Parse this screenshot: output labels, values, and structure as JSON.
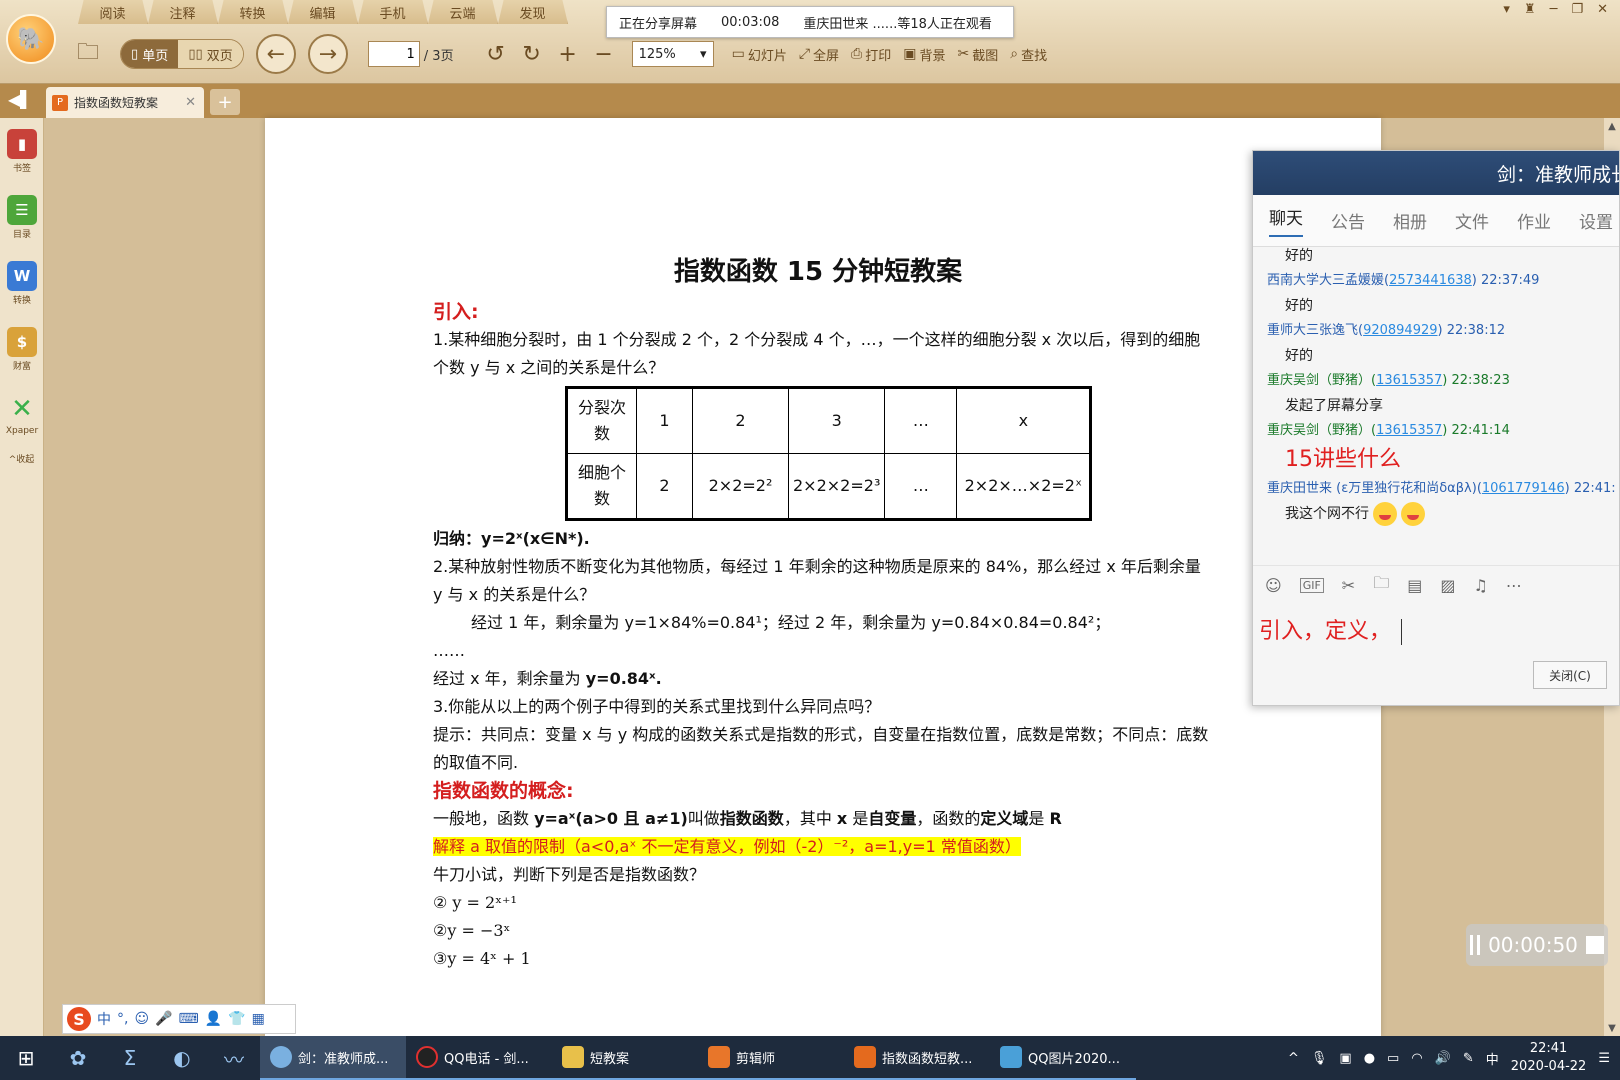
{
  "menu": [
    "阅读",
    "注释",
    "转换",
    "编辑",
    "手机",
    "云端",
    "发现"
  ],
  "share": {
    "status": "正在分享屏幕",
    "time": "00:03:08",
    "viewers": "重庆田世来 ......等18人正在观看"
  },
  "toolbar": {
    "single_page": "单页",
    "double_page": "双页",
    "page_current": "1",
    "page_total": "/ 3页",
    "zoom": "125%",
    "tools": [
      "幻灯片",
      "全屏",
      "打印",
      "背景",
      "截图",
      "查找"
    ]
  },
  "tab": {
    "title": "指数函数短教案"
  },
  "sidebar": [
    "书签",
    "目录",
    "转换",
    "财富",
    "Xpaper"
  ],
  "sidebar_collapse": "收起",
  "doc": {
    "title": "指数函数 15 分钟短教案",
    "sec1": "引入:",
    "q1": "1.某种细胞分裂时，由 1 个分裂成 2 个，2 个分裂成 4 个，…，一个这样的细胞分裂 x 次以后，得到的细胞个数 y 与 x 之间的关系是什么？",
    "table": {
      "row1": [
        "分裂次数",
        "1",
        "2",
        "3",
        "…",
        "x"
      ],
      "row2": [
        "细胞个数",
        "2",
        "2×2=2²",
        "2×2×2=2³",
        "…",
        "2×2×…×2=2ˣ"
      ]
    },
    "summary_label": "归纳：",
    "summary_formula": "y=2ˣ(x∈N*).",
    "q2": "2.某种放射性物质不断变化为其他物质，每经过 1 年剩余的这种物质是原来的 84%，那么经过 x 年后剩余量 y 与 x 的关系是什么？",
    "q2_a": "经过 1 年，剩余量为 y=1×84%=0.84¹；经过 2 年，剩余量为 y=0.84×0.84=0.84²；",
    "ellipsis": "……",
    "q2_b_pre": "经过 x 年，剩余量为 ",
    "q2_b_formula": "y=0.84ˣ.",
    "q3": "3.你能从以上的两个例子中得到的关系式里找到什么异同点吗？",
    "hint": "提示：共同点：变量 x 与 y 构成的函数关系式是指数的形式，自变量在指数位置，底数是常数；不同点：底数的取值不同.",
    "sec2": "指数函数的概念:",
    "def_1": "一般地，函数 ",
    "def_formula": "y=aˣ(a>0 且 a≠1)",
    "def_2": "叫做",
    "def_term": "指数函数",
    "def_3": "，其中 ",
    "def_x": "x",
    "def_4": " 是",
    "def_var": "自变量",
    "def_5": "，函数的",
    "def_domain": "定义域",
    "def_6": "是 ",
    "def_R": "R",
    "highlight": "解释 a 取值的限制（a<0,aˣ 不一定有意义，例如（-2）⁻²，a=1,y=1 常值函数）",
    "quiz": "牛刀小试，判断下列是否是指数函数？",
    "items": [
      "②  y = 2ˣ⁺¹",
      "②y = −3ˣ",
      "③y = 4ˣ + 1"
    ]
  },
  "chat": {
    "title": "剑：准教师成长",
    "tabs": [
      "聊天",
      "公告",
      "相册",
      "文件",
      "作业",
      "设置"
    ],
    "messages": [
      {
        "text": "好的"
      },
      {
        "name": "西南大学大三孟媛媛(",
        "qq": "2573441638",
        "time": ") 22:37:49",
        "text": "好的"
      },
      {
        "name": "重师大三张逸飞(",
        "qq": "920894929",
        "time": ") 22:38:12",
        "text": "好的"
      },
      {
        "name": "重庆吴剑（野猪）(",
        "qq": "13615357",
        "time": ") 22:38:23",
        "text": "发起了屏幕分享"
      },
      {
        "name": "重庆吴剑（野猪）(",
        "qq": "13615357",
        "time": ") 22:41:14",
        "text": "15讲些什么"
      },
      {
        "name": "重庆田世来 (ε万里独行花和尚δαβλ)(",
        "qq": "1061779146",
        "time": ") 22:41:",
        "text": "我这个网不行"
      }
    ],
    "input": "引入，定义，",
    "close": "关闭(C)"
  },
  "recorder": {
    "time": "00:00:50"
  },
  "ime": "中",
  "taskbar": {
    "items": [
      "剑：准教师成...",
      "QQ电话 - 剑...",
      "短教案",
      "剪辑师",
      "指数函数短教...",
      "QQ图片2020..."
    ],
    "ime": "中",
    "time": "22:41",
    "date": "2020-04-22"
  },
  "colors": {
    "accent_red": "#d41e1e",
    "highlight": "#ffff00",
    "chat_header": "#2e4d78",
    "taskbar": "#1e2b3d"
  }
}
